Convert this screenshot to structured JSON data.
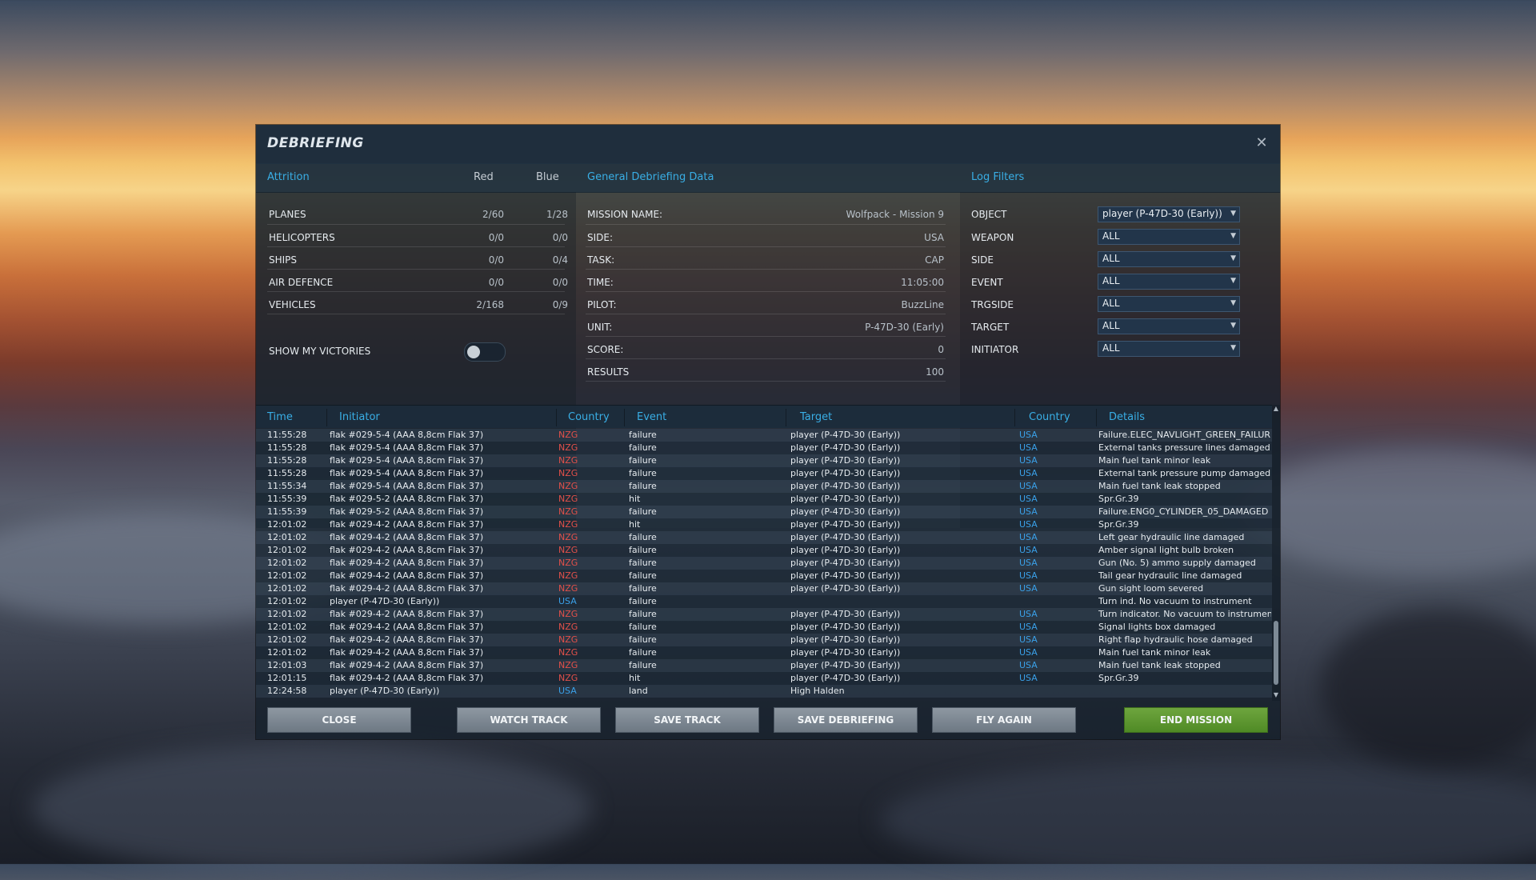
{
  "dialog": {
    "title": "DEBRIEFING"
  },
  "attrition": {
    "header": "Attrition",
    "col_red": "Red",
    "col_blue": "Blue",
    "rows": [
      {
        "label": "PLANES",
        "red": "2/60",
        "blue": "1/28"
      },
      {
        "label": "HELICOPTERS",
        "red": "0/0",
        "blue": "0/0"
      },
      {
        "label": "SHIPS",
        "red": "0/0",
        "blue": "0/4"
      },
      {
        "label": "AIR DEFENCE",
        "red": "0/0",
        "blue": "0/0"
      },
      {
        "label": "VEHICLES",
        "red": "2/168",
        "blue": "0/9"
      }
    ],
    "show_victories_label": "SHOW MY VICTORIES"
  },
  "general": {
    "header": "General Debriefing Data",
    "rows": [
      {
        "label": "MISSION NAME:",
        "value": "Wolfpack - Mission 9"
      },
      {
        "label": "SIDE:",
        "value": "USA"
      },
      {
        "label": "TASK:",
        "value": "CAP"
      },
      {
        "label": "TIME:",
        "value": "11:05:00"
      },
      {
        "label": "PILOT:",
        "value": "BuzzLine"
      },
      {
        "label": "UNIT:",
        "value": "P-47D-30 (Early)"
      },
      {
        "label": "SCORE:",
        "value": "0"
      },
      {
        "label": "RESULTS",
        "value": "100"
      }
    ]
  },
  "log_filters": {
    "header": "Log Filters",
    "rows": [
      {
        "label": "OBJECT",
        "value": "player (P-47D-30 (Early))"
      },
      {
        "label": "WEAPON",
        "value": "ALL"
      },
      {
        "label": "SIDE",
        "value": "ALL"
      },
      {
        "label": "EVENT",
        "value": "ALL"
      },
      {
        "label": "TRGSIDE",
        "value": "ALL"
      },
      {
        "label": "TARGET",
        "value": "ALL"
      },
      {
        "label": "INITIATOR",
        "value": "ALL"
      }
    ]
  },
  "log_table": {
    "columns": [
      "Time",
      "Initiator",
      "Country",
      "Event",
      "Target",
      "Country",
      "Details"
    ],
    "rows": [
      [
        "11:55:28",
        "flak #029-5-4 (AAA 8,8cm Flak 37)",
        "NZG",
        "failure",
        "player (P-47D-30 (Early))",
        "USA",
        "Failure.ELEC_NAVLIGHT_GREEN_FAILURE"
      ],
      [
        "11:55:28",
        "flak #029-5-4 (AAA 8,8cm Flak 37)",
        "NZG",
        "failure",
        "player (P-47D-30 (Early))",
        "USA",
        "External tanks pressure lines damaged"
      ],
      [
        "11:55:28",
        "flak #029-5-4 (AAA 8,8cm Flak 37)",
        "NZG",
        "failure",
        "player (P-47D-30 (Early))",
        "USA",
        "Main fuel tank minor leak"
      ],
      [
        "11:55:28",
        "flak #029-5-4 (AAA 8,8cm Flak 37)",
        "NZG",
        "failure",
        "player (P-47D-30 (Early))",
        "USA",
        "External tank pressure pump damaged"
      ],
      [
        "11:55:34",
        "flak #029-5-4 (AAA 8,8cm Flak 37)",
        "NZG",
        "failure",
        "player (P-47D-30 (Early))",
        "USA",
        "Main fuel tank leak stopped"
      ],
      [
        "11:55:39",
        "flak #029-5-2 (AAA 8,8cm Flak 37)",
        "NZG",
        "hit",
        "player (P-47D-30 (Early))",
        "USA",
        "Spr.Gr.39"
      ],
      [
        "11:55:39",
        "flak #029-5-2 (AAA 8,8cm Flak 37)",
        "NZG",
        "failure",
        "player (P-47D-30 (Early))",
        "USA",
        "Failure.ENG0_CYLINDER_05_DAMAGED"
      ],
      [
        "12:01:02",
        "flak #029-4-2 (AAA 8,8cm Flak 37)",
        "NZG",
        "hit",
        "player (P-47D-30 (Early))",
        "USA",
        "Spr.Gr.39"
      ],
      [
        "12:01:02",
        "flak #029-4-2 (AAA 8,8cm Flak 37)",
        "NZG",
        "failure",
        "player (P-47D-30 (Early))",
        "USA",
        "Left gear hydraulic line damaged"
      ],
      [
        "12:01:02",
        "flak #029-4-2 (AAA 8,8cm Flak 37)",
        "NZG",
        "failure",
        "player (P-47D-30 (Early))",
        "USA",
        "Amber signal light bulb broken"
      ],
      [
        "12:01:02",
        "flak #029-4-2 (AAA 8,8cm Flak 37)",
        "NZG",
        "failure",
        "player (P-47D-30 (Early))",
        "USA",
        "Gun (No. 5) ammo supply damaged"
      ],
      [
        "12:01:02",
        "flak #029-4-2 (AAA 8,8cm Flak 37)",
        "NZG",
        "failure",
        "player (P-47D-30 (Early))",
        "USA",
        "Tail gear hydraulic line damaged"
      ],
      [
        "12:01:02",
        "flak #029-4-2 (AAA 8,8cm Flak 37)",
        "NZG",
        "failure",
        "player (P-47D-30 (Early))",
        "USA",
        "Gun sight loom severed"
      ],
      [
        "12:01:02",
        "player (P-47D-30 (Early))",
        "USA",
        "failure",
        "",
        "",
        "Turn ind. No vacuum to instrument"
      ],
      [
        "12:01:02",
        "flak #029-4-2 (AAA 8,8cm Flak 37)",
        "NZG",
        "failure",
        "player (P-47D-30 (Early))",
        "USA",
        "Turn indicator. No vacuum to instrumen"
      ],
      [
        "12:01:02",
        "flak #029-4-2 (AAA 8,8cm Flak 37)",
        "NZG",
        "failure",
        "player (P-47D-30 (Early))",
        "USA",
        "Signal lights box damaged"
      ],
      [
        "12:01:02",
        "flak #029-4-2 (AAA 8,8cm Flak 37)",
        "NZG",
        "failure",
        "player (P-47D-30 (Early))",
        "USA",
        "Right flap hydraulic hose damaged"
      ],
      [
        "12:01:02",
        "flak #029-4-2 (AAA 8,8cm Flak 37)",
        "NZG",
        "failure",
        "player (P-47D-30 (Early))",
        "USA",
        "Main fuel tank minor leak"
      ],
      [
        "12:01:03",
        "flak #029-4-2 (AAA 8,8cm Flak 37)",
        "NZG",
        "failure",
        "player (P-47D-30 (Early))",
        "USA",
        "Main fuel tank leak stopped"
      ],
      [
        "12:01:15",
        "flak #029-4-2 (AAA 8,8cm Flak 37)",
        "NZG",
        "hit",
        "player (P-47D-30 (Early))",
        "USA",
        "Spr.Gr.39"
      ],
      [
        "12:24:58",
        "player (P-47D-30 (Early))",
        "USA",
        "land",
        "High Halden",
        "",
        ""
      ]
    ]
  },
  "buttons": {
    "close": "CLOSE",
    "watch_track": "WATCH TRACK",
    "save_track": "SAVE TRACK",
    "save_debriefing": "SAVE DEBRIEFING",
    "fly_again": "FLY AGAIN",
    "end_mission": "END MISSION"
  },
  "icons": {
    "close": "close-icon",
    "dropdown": "chevron-down-icon"
  },
  "colors": {
    "accent": "#39aee5",
    "red_side": "#e2504a",
    "blue_side": "#3aa0e8",
    "end_mission": "#5f9a30"
  }
}
